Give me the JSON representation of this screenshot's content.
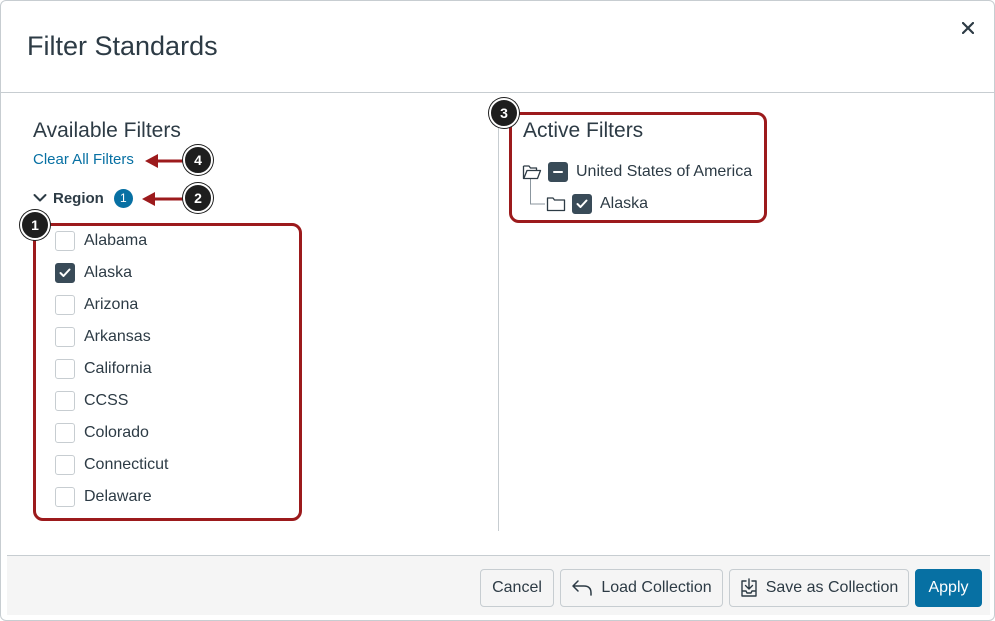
{
  "modal": {
    "title": "Filter Standards"
  },
  "available": {
    "heading": "Available Filters",
    "clear_label": "Clear All Filters",
    "region": {
      "label": "Region",
      "badge": "1",
      "options": [
        {
          "label": "Alabama",
          "checked": false
        },
        {
          "label": "Alaska",
          "checked": true
        },
        {
          "label": "Arizona",
          "checked": false
        },
        {
          "label": "Arkansas",
          "checked": false
        },
        {
          "label": "California",
          "checked": false
        },
        {
          "label": "CCSS",
          "checked": false
        },
        {
          "label": "Colorado",
          "checked": false
        },
        {
          "label": "Connecticut",
          "checked": false
        },
        {
          "label": "Delaware",
          "checked": false
        }
      ]
    }
  },
  "active": {
    "heading": "Active Filters",
    "tree": {
      "parent": {
        "label": "United States of America",
        "state": "partial"
      },
      "child": {
        "label": "Alaska",
        "state": "checked"
      }
    }
  },
  "footer": {
    "cancel": "Cancel",
    "load": "Load Collection",
    "save": "Save as Collection",
    "apply": "Apply"
  },
  "callouts": [
    "1",
    "2",
    "3",
    "4"
  ],
  "colors": {
    "accent": "#0770a3",
    "callout": "#9c1a1c",
    "checkbox": "#394b58"
  }
}
